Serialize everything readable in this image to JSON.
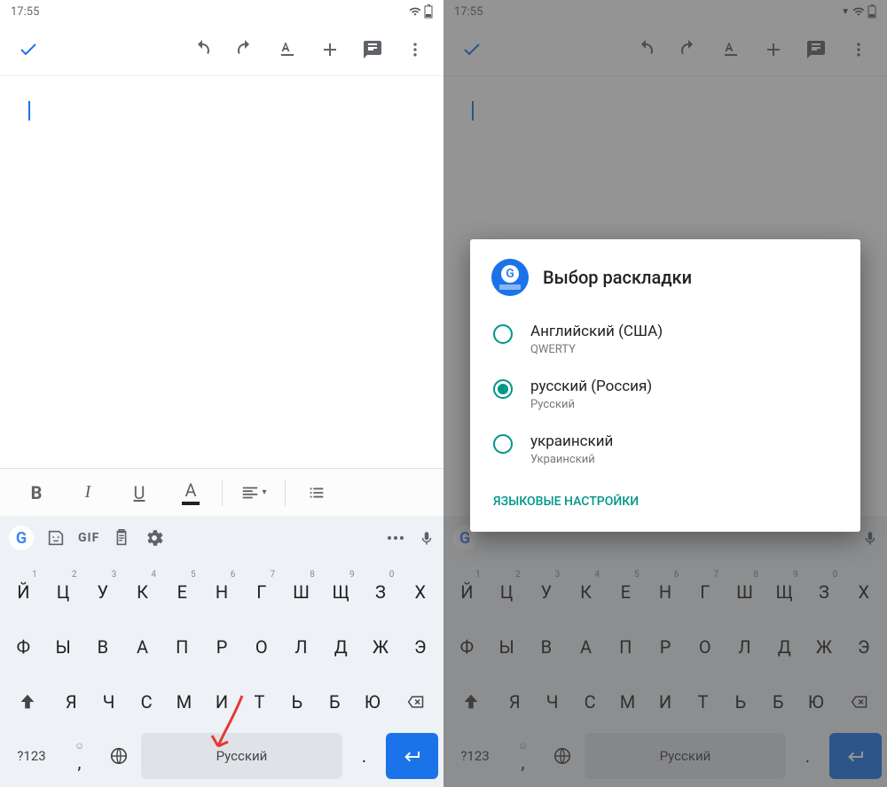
{
  "status": {
    "time": "17:55"
  },
  "toolbar_icons": [
    "check",
    "undo",
    "redo",
    "text-format",
    "plus",
    "comment",
    "more-vert"
  ],
  "format_bar": {
    "bold": "B",
    "italic": "I",
    "underline": "U",
    "textcolor": "A",
    "align": "≡",
    "list": "≡"
  },
  "suggest_bar": {
    "gif": "GIF"
  },
  "keyboard": {
    "row1": [
      {
        "ch": "Й",
        "n": "1"
      },
      {
        "ch": "Ц",
        "n": "2"
      },
      {
        "ch": "У",
        "n": "3"
      },
      {
        "ch": "К",
        "n": "4"
      },
      {
        "ch": "Е",
        "n": "5"
      },
      {
        "ch": "Н",
        "n": "6"
      },
      {
        "ch": "Г",
        "n": "7"
      },
      {
        "ch": "Ш",
        "n": "8"
      },
      {
        "ch": "Щ",
        "n": "9"
      },
      {
        "ch": "З",
        "n": "0"
      },
      {
        "ch": "Х",
        "n": ""
      }
    ],
    "row2": [
      "Ф",
      "Ы",
      "В",
      "А",
      "П",
      "Р",
      "О",
      "Л",
      "Д",
      "Ж",
      "Э"
    ],
    "row3": [
      "Я",
      "Ч",
      "С",
      "М",
      "И",
      "Т",
      "Ь",
      "Б",
      "Ю"
    ],
    "symbols": "?123",
    "comma": ",",
    "emoji": "☺",
    "period": ".",
    "spacebar": "Русский"
  },
  "dialog": {
    "title": "Выбор раскладки",
    "options": [
      {
        "label": "Английский (США)",
        "sub": "QWERTY",
        "selected": false
      },
      {
        "label": "русский (Россия)",
        "sub": "Русский",
        "selected": true
      },
      {
        "label": "украинский",
        "sub": "Украинский",
        "selected": false
      }
    ],
    "action": "ЯЗЫКОВЫЕ НАСТРОЙКИ"
  }
}
